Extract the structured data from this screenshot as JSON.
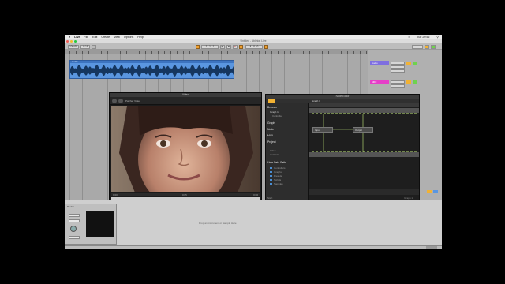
{
  "menubar": {
    "app": "Live",
    "items": [
      "File",
      "Edit",
      "Create",
      "View",
      "Options",
      "Help"
    ],
    "clock": "Tue 20:56"
  },
  "window": {
    "title": "Untitled - Ableton Live"
  },
  "transport": {
    "tempo": "120.00",
    "signature": "4 / 4",
    "position": "1 . 1 . 1",
    "loop_end": "4 . 0 . 0"
  },
  "arrangement": {
    "clip_name": "Audio"
  },
  "mixer": {
    "clip1": "Audio",
    "clip2": "MIDI",
    "accent_colors": {
      "blue": "#5a96e0",
      "pink": "#e63ec8",
      "purple": "#7f6fe0",
      "orange": "#f2b233",
      "green": "#6fd24e"
    }
  },
  "video_window": {
    "title": "Video",
    "subtitle": "Patcher Video",
    "time_start": "0:00",
    "time_mid": "0:05",
    "time_end": "0:00",
    "path": "Video.mp4"
  },
  "node_editor": {
    "title": "Node Editor",
    "graph_tab": "Graph 1",
    "sidebar": {
      "sections": [
        "Browser",
        "Graph",
        "Node",
        "MIDI",
        "Project",
        "User Data Path"
      ],
      "browser_items": [
        "Graph 1",
        "Controller"
      ],
      "search_items": [
        "Video",
        "Analysis"
      ],
      "folders": [
        "Controllers",
        "Graphs",
        "Presets",
        "Scripts",
        "Samples"
      ]
    },
    "nodes": [
      "Input",
      "Output"
    ],
    "footer_left": "Start",
    "footer_right": "Graph 1"
  },
  "device_strip": {
    "title": "Device",
    "drop_message": "Drop an Instrument or Sample Here"
  },
  "icons": [
    "apple-icon",
    "play-icon",
    "stop-icon",
    "record-icon",
    "search-icon",
    "folder-icon",
    "close-icon"
  ]
}
